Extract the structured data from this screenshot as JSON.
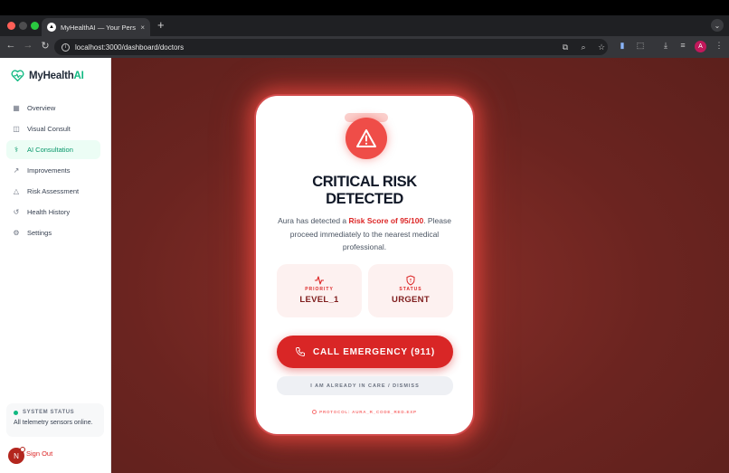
{
  "browser": {
    "tab_title": "MyHealthAI — Your Personal",
    "tab_close": "×",
    "new_tab": "+",
    "url": "localhost:3000/dashboard/doctors",
    "profile_initial": "A"
  },
  "app": {
    "brand": {
      "name_main": "MyHealth",
      "name_accent": "AI"
    },
    "nav": [
      {
        "label": "Overview",
        "icon": "grid-icon",
        "active": false
      },
      {
        "label": "Visual Consult",
        "icon": "camera-icon",
        "active": false
      },
      {
        "label": "AI Consultation",
        "icon": "stethoscope-icon",
        "active": true
      },
      {
        "label": "Improvements",
        "icon": "trend-arrow-icon",
        "active": false
      },
      {
        "label": "Risk Assessment",
        "icon": "warning-triangle-icon",
        "active": false
      },
      {
        "label": "Health History",
        "icon": "history-icon",
        "active": false
      },
      {
        "label": "Settings",
        "icon": "gear-icon",
        "active": false
      }
    ],
    "system_status": {
      "label": "SYSTEM STATUS",
      "message": "All telemetry sensors online."
    },
    "user_initial": "N",
    "sign_out": "Sign Out"
  },
  "alert": {
    "tag": "",
    "title_line1": "CRITICAL RISK",
    "title_line2": "DETECTED",
    "desc_prefix": "Aura has detected a ",
    "desc_risk": "Risk Score of 95/100",
    "desc_suffix": ". Please proceed immediately to the nearest medical professional.",
    "priority": {
      "label": "PRIORITY",
      "value": "LEVEL_1"
    },
    "status": {
      "label": "STATUS",
      "value": "URGENT"
    },
    "call_button": "CALL EMERGENCY (911)",
    "dismiss_button": "I AM ALREADY IN CARE / DISMISS",
    "protocol": "PROTOCOL: AURA_R_CODE_RED.EXP"
  },
  "colors": {
    "accent_green": "#10b981",
    "danger_red": "#d92626",
    "overlay": "#6b2420"
  }
}
